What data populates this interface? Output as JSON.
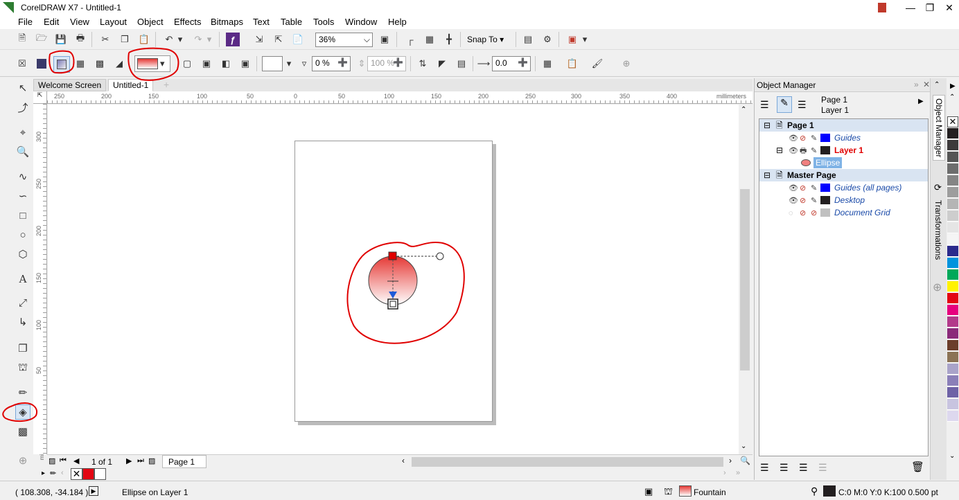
{
  "title_bar": {
    "title": "CorelDRAW X7 - Untitled-1"
  },
  "menu": [
    "File",
    "Edit",
    "View",
    "Layout",
    "Object",
    "Effects",
    "Bitmaps",
    "Text",
    "Table",
    "Tools",
    "Window",
    "Help"
  ],
  "std_toolbar": {
    "zoom": "36%",
    "snap_to": "Snap To"
  },
  "prop_toolbar": {
    "transparency": "0 %",
    "opacity": "100 %",
    "offset": "0.0"
  },
  "doc_tabs": [
    "Welcome Screen",
    "Untitled-1"
  ],
  "ruler": {
    "units": "millimeters",
    "h_ticks": [
      "250",
      "200",
      "150",
      "100",
      "50",
      "0",
      "50",
      "100",
      "150",
      "200",
      "250",
      "300",
      "350",
      "400"
    ],
    "v_ticks": [
      "300",
      "250",
      "200",
      "150",
      "100",
      "50"
    ]
  },
  "page_nav": {
    "counter": "1 of 1",
    "page_tab": "Page 1"
  },
  "object_manager": {
    "title": "Object Manager",
    "current_page": "Page 1",
    "current_layer": "Layer 1",
    "tree": [
      {
        "label": "Page 1",
        "type": "page"
      },
      {
        "label": "Guides",
        "type": "layer",
        "color": "#0000ff"
      },
      {
        "label": "Layer 1",
        "type": "active-layer",
        "color": "#231f20"
      },
      {
        "label": "Ellipse",
        "type": "object"
      },
      {
        "label": "Master Page",
        "type": "page"
      },
      {
        "label": "Guides (all pages)",
        "type": "layer",
        "color": "#0000ff"
      },
      {
        "label": "Desktop",
        "type": "layer",
        "color": "#231f20"
      },
      {
        "label": "Document Grid",
        "type": "layer",
        "color": "#c0c0c0"
      }
    ]
  },
  "docker_tabs": [
    "Object Manager",
    "Transformations"
  ],
  "palette_colors": [
    "#231f20",
    "#3d3a3b",
    "#555",
    "#6d6d6d",
    "#858585",
    "#9d9d9d",
    "#b5b5b5",
    "#cdcdcd",
    "#e5e5e5",
    "#f5f5f5",
    "#2b2a8c",
    "#0093dd",
    "#00a859",
    "#fff200",
    "#e30613",
    "#e6007e",
    "#b23a8a",
    "#8a2a7a",
    "#6b3d2a",
    "#8b7355",
    "#a9a3c9",
    "#8a7fb8",
    "#6e62a6",
    "#c8c4e0",
    "#ddd8ee"
  ],
  "status": {
    "coords": "( 108.308, -34.184 )",
    "object_info": "Ellipse on Layer 1",
    "fill_label": "Fountain",
    "outline_info": "C:0 M:0 Y:0 K:100  0.500 pt"
  },
  "colors": {
    "accent_red": "#e30613",
    "fill_gradient_top": "#e53935",
    "annotation": "#e00000"
  }
}
